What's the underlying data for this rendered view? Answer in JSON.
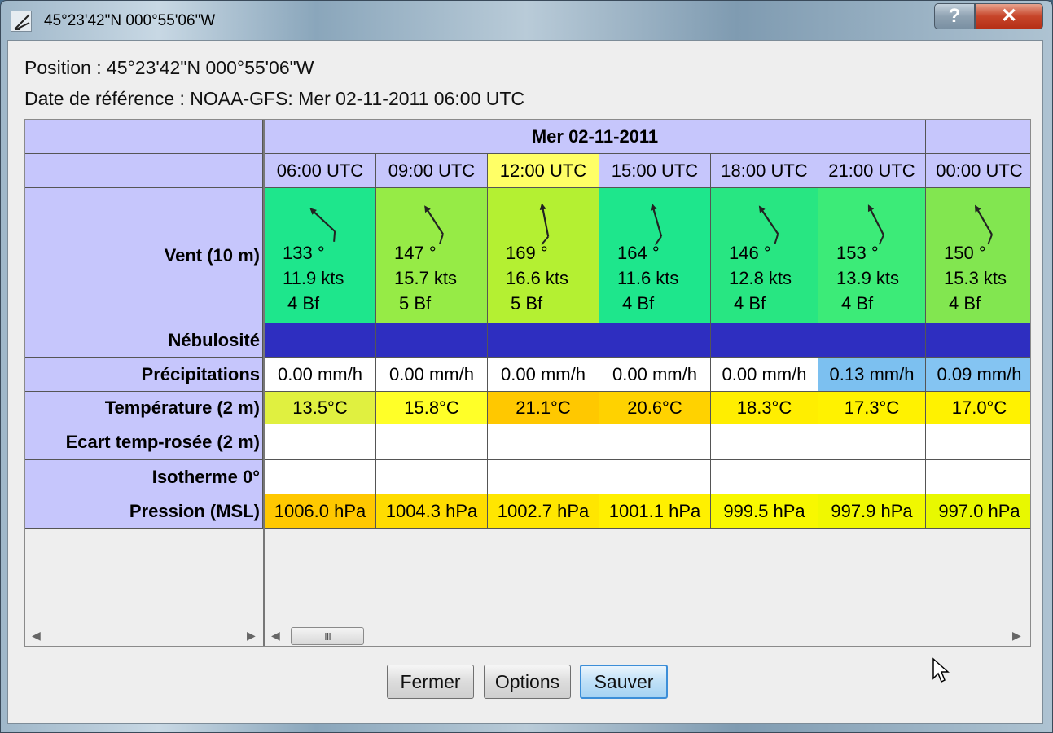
{
  "window": {
    "title": "45°23'42\"N  000°55'06\"W",
    "help_label": "?",
    "close_label": "✕"
  },
  "info": {
    "position": "Position :  45°23'42\"N  000°55'06\"W",
    "reference_date": "Date de référence : NOAA-GFS: Mer 02-11-2011 06:00 UTC"
  },
  "table": {
    "row_labels": {
      "wind": "Vent (10 m)",
      "cloud": "Nébulosité",
      "precip": "Précipitations",
      "temp": "Température (2 m)",
      "dewpoint": "Ecart temp-rosée (2 m)",
      "isotherm": "Isotherme 0°",
      "pressure": "Pression (MSL)"
    },
    "date_label": "Mer 02-11-2011",
    "columns": [
      {
        "time": "06:00 UTC",
        "highlight": false,
        "wind_dir_deg": 133,
        "wind_dir": "133 °",
        "wind_speed": "11.9  kts",
        "beaufort": "4 Bf",
        "wind_color": "#1ee68c",
        "precip": "0.00 mm/h",
        "precip_color": "#ffffff",
        "temp": "13.5°C",
        "temp_color": "#e0f040",
        "pressure": "1006.0 hPa",
        "pressure_color": "#ffc800"
      },
      {
        "time": "09:00 UTC",
        "highlight": false,
        "wind_dir_deg": 147,
        "wind_dir": "147 °",
        "wind_speed": "15.7  kts",
        "beaufort": "5 Bf",
        "wind_color": "#96eb46",
        "precip": "0.00 mm/h",
        "precip_color": "#ffffff",
        "temp": "15.8°C",
        "temp_color": "#ffff28",
        "pressure": "1004.3 hPa",
        "pressure_color": "#ffdc00"
      },
      {
        "time": "12:00 UTC",
        "highlight": true,
        "wind_dir_deg": 169,
        "wind_dir": "169 °",
        "wind_speed": "16.6  kts",
        "beaufort": "5 Bf",
        "wind_color": "#b4f032",
        "precip": "0.00 mm/h",
        "precip_color": "#ffffff",
        "temp": "21.1°C",
        "temp_color": "#ffc800",
        "pressure": "1002.7 hPa",
        "pressure_color": "#ffe600"
      },
      {
        "time": "15:00 UTC",
        "highlight": false,
        "wind_dir_deg": 164,
        "wind_dir": "164 °",
        "wind_speed": "11.6  kts",
        "beaufort": "4 Bf",
        "wind_color": "#1ee68c",
        "precip": "0.00 mm/h",
        "precip_color": "#ffffff",
        "temp": "20.6°C",
        "temp_color": "#ffd200",
        "pressure": "1001.1 hPa",
        "pressure_color": "#fff000"
      },
      {
        "time": "18:00 UTC",
        "highlight": false,
        "wind_dir_deg": 146,
        "wind_dir": "146 °",
        "wind_speed": "12.8  kts",
        "beaufort": "4 Bf",
        "wind_color": "#28e682",
        "precip": "0.00 mm/h",
        "precip_color": "#ffffff",
        "temp": "18.3°C",
        "temp_color": "#ffee00",
        "pressure": "999.5 hPa",
        "pressure_color": "#f8f800"
      },
      {
        "time": "21:00 UTC",
        "highlight": false,
        "wind_dir_deg": 153,
        "wind_dir": "153 °",
        "wind_speed": "13.9  kts",
        "beaufort": "4 Bf",
        "wind_color": "#3ceb78",
        "precip": "0.13 mm/h",
        "precip_color": "#7cc0f0",
        "temp": "17.3°C",
        "temp_color": "#fff200",
        "pressure": "997.9 hPa",
        "pressure_color": "#f0f800"
      },
      {
        "time": "00:00 UTC",
        "highlight": false,
        "wind_dir_deg": 150,
        "wind_dir": "150 °",
        "wind_speed": "15.3  kts",
        "beaufort": "4 Bf",
        "wind_color": "#82e650",
        "precip": "0.09 mm/h",
        "precip_color": "#84c4f2",
        "temp": "17.0°C",
        "temp_color": "#fff200",
        "pressure": "997.0 hPa",
        "pressure_color": "#e8f800"
      }
    ],
    "cloud_color": "#2e2ec0",
    "scroll_thumb_glyph": "III",
    "scroll_left_glyph": "◀",
    "scroll_right_glyph": "▶"
  },
  "buttons": {
    "close": "Fermer",
    "options": "Options",
    "save": "Sauver"
  }
}
